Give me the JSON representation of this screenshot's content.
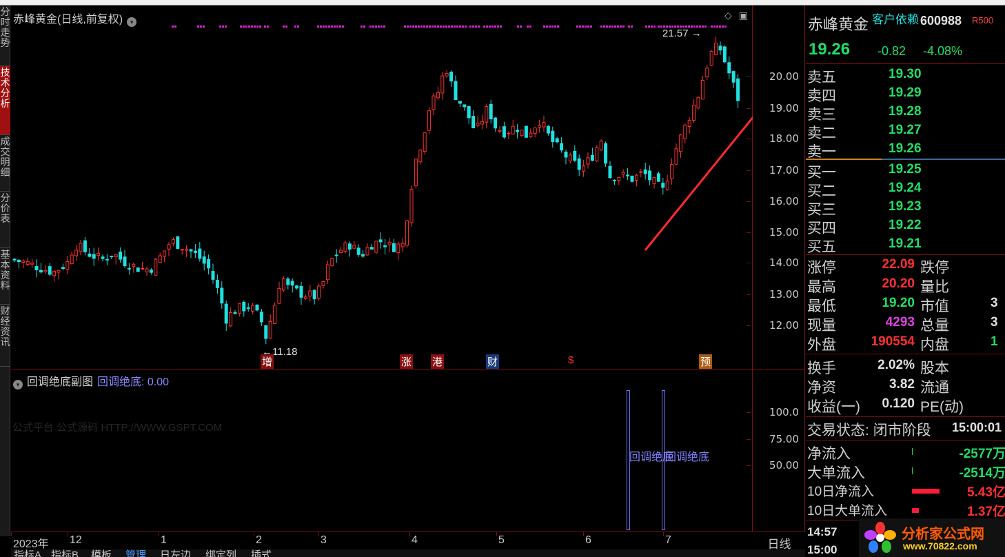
{
  "left_tabs": [
    "分时走势",
    "技术分析",
    "成交明细",
    "分价表",
    "基本资料",
    "财经资讯"
  ],
  "chart": {
    "title": "赤峰黄金(日线,前复权)",
    "y_ticks": [
      "20.00",
      "19.00",
      "18.00",
      "17.00",
      "16.00",
      "15.00",
      "14.00",
      "13.00",
      "12.00"
    ],
    "high_marker": "21.57",
    "low_marker": "11.18",
    "event_tags": [
      "增",
      "涨",
      "港",
      "财",
      "$",
      "预"
    ]
  },
  "sub_chart": {
    "title": "回调绝底副图",
    "indicator_label": "回调绝底: 0.00",
    "watermark": "公式平台 公式源码 HTTP://WWW.GSPT.COM",
    "y_ticks": [
      "100.0",
      "75.00",
      "50.00"
    ],
    "signal_text_1": "回调绝底",
    "signal_text_2": "回调绝底"
  },
  "x_axis": {
    "labels": [
      "2023年",
      "12",
      "1",
      "2",
      "3",
      "4",
      "5",
      "6",
      "7"
    ],
    "period": "日线"
  },
  "bottom_tabs": [
    "指标A",
    "指标B",
    "模板",
    "管理",
    "日左边",
    "绑定列",
    "插式"
  ],
  "quote": {
    "name": "赤峰黄金",
    "concept": "客户依赖",
    "code": "600988",
    "flag": "R",
    "flag_value": "500",
    "price": "19.26",
    "change": "-0.82",
    "change_pct": "-4.08%",
    "asks": [
      {
        "label": "卖五",
        "price": "19.30"
      },
      {
        "label": "卖四",
        "price": "19.29"
      },
      {
        "label": "卖三",
        "price": "19.28"
      },
      {
        "label": "卖二",
        "price": "19.27"
      },
      {
        "label": "卖一",
        "price": "19.26"
      }
    ],
    "bids": [
      {
        "label": "买一",
        "price": "19.25"
      },
      {
        "label": "买二",
        "price": "19.24"
      },
      {
        "label": "买三",
        "price": "19.23"
      },
      {
        "label": "买四",
        "price": "19.22"
      },
      {
        "label": "买五",
        "price": "19.21"
      }
    ],
    "stats": {
      "limit_up_label": "涨停",
      "limit_up": "22.09",
      "limit_down_label": "跌停",
      "high_label": "最高",
      "high": "20.20",
      "vol_ratio_label": "量比",
      "low_label": "最低",
      "low": "19.20",
      "mktcap_label": "市值",
      "mktcap_partial": "3",
      "cur_vol_label": "现量",
      "cur_vol": "4293",
      "total_vol_label": "总量",
      "total_vol_partial": "3",
      "outer_label": "外盘",
      "outer": "190554",
      "inner_label": "内盘",
      "inner_partial": "1",
      "turnover_label": "换手",
      "turnover": "2.02%",
      "share_cap_label": "股本",
      "nav_label": "净资",
      "nav": "3.82",
      "float_label": "流通",
      "eps_label": "收益(一)",
      "eps": "0.120",
      "pe_label": "PE(动)"
    },
    "trade_status": "交易状态: 闭市阶段",
    "trade_time": "15:00:01",
    "flows": [
      {
        "label": "净流入",
        "value": "-2577万",
        "bar": 0
      },
      {
        "label": "大单流入",
        "value": "-2514万",
        "bar": 0
      },
      {
        "label": "10日净流入",
        "value": "5.43亿",
        "bar": 1
      },
      {
        "label": "10日大单流入",
        "value": "1.37亿",
        "bar": 0.25
      }
    ],
    "ticks": [
      "14:57",
      "15:00"
    ]
  },
  "logo": {
    "text": "分析家公式网",
    "url": "www.70822.com"
  }
}
